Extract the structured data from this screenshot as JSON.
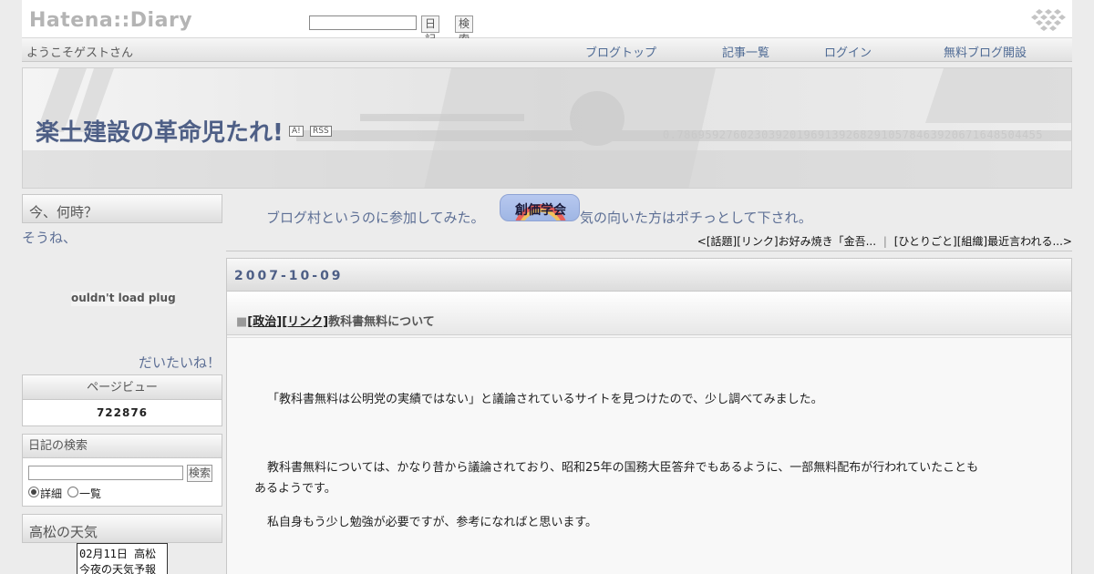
{
  "hatena_bar": {
    "logo": "Hatena::Diary",
    "search_value": "",
    "diary_button": "日記",
    "search_button": "検索"
  },
  "menu": {
    "welcome": "ようこそゲストさん",
    "items": [
      "ブログトップ",
      "記事一覧",
      "ログイン",
      "無料ブログ開設"
    ]
  },
  "banner": {
    "title": "楽土建設の革命児たれ!",
    "badge_a": "A!",
    "badge_rss": "RSS",
    "deco_digits": "0.7869592760230392019691392682910578463920671648504455"
  },
  "sidebar": {
    "clock_heading": "今、何時？",
    "clock_text": "そうね、",
    "plugin_error": "ouldn't load plugi",
    "clock_suffix": "だいたいね！",
    "pageview_heading": "ページビュー",
    "pageview_count": "722876",
    "search_heading": "日記の検索",
    "search_value": "",
    "search_button": "検索",
    "radio_detail": "詳細",
    "radio_list": "一覧",
    "weather_heading": "高松の天気",
    "weather_line1": "02月11日 高松",
    "weather_line2": "今夜の天気予報"
  },
  "main": {
    "promo_text1": "ブログ村というのに参加してみた。",
    "promo_badge": "創価学会",
    "promo_text2": "気の向いた方はポチっとして下され。",
    "nav_prev": "<[話題][リンク]お好み焼き「金吾...",
    "nav_sep": "|",
    "nav_next": "[ひとりごと][組織]最近言われる...>",
    "date": "2007-10-09",
    "section": {
      "marker": "■",
      "cat1": "[政治]",
      "cat2": "[リンク]",
      "title": "教科書無料について"
    },
    "paragraphs": [
      "「教科書無料は公明党の実績ではない」と議論されているサイトを見つけたので、少し調べてみました。",
      "教科書無料については、かなり昔から議論されており、昭和25年の国務大臣答弁でもあるように、一部無料配布が行われていたことも",
      "あるようです。",
      "私自身もう少し勉強が必要ですが、参考になればと思います。"
    ]
  },
  "colors": {
    "title": "#4e5f86",
    "link": "#4e6a94",
    "background": "#ececec"
  }
}
